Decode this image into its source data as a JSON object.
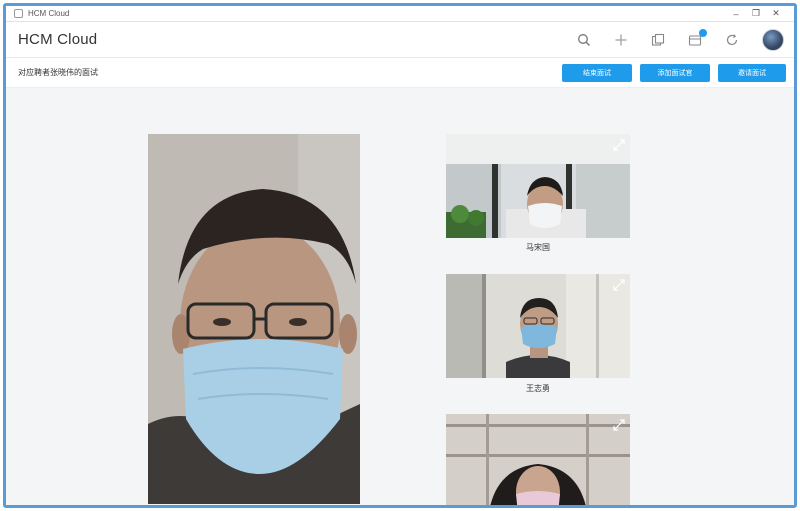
{
  "window": {
    "title": "HCM Cloud",
    "controls": [
      "–",
      "❐",
      "✕"
    ]
  },
  "header": {
    "brand": "HCM Cloud",
    "icons": [
      "search-icon",
      "plus-icon",
      "copy-icon",
      "notification-icon",
      "refresh-icon"
    ],
    "avatar": "user-avatar"
  },
  "toolbar": {
    "subtitle": "对应聘者张晓伟的面试",
    "buttons": [
      {
        "label": "结束面试"
      },
      {
        "label": "添加面试官"
      },
      {
        "label": "邀请面试"
      }
    ]
  },
  "participants": [
    {
      "name": "马宋国"
    },
    {
      "name": "王志勇"
    },
    {
      "name": ""
    }
  ],
  "colors": {
    "accent": "#1e9bea",
    "frame_border": "#5b9bd5",
    "mask": "#a9cfe6"
  }
}
